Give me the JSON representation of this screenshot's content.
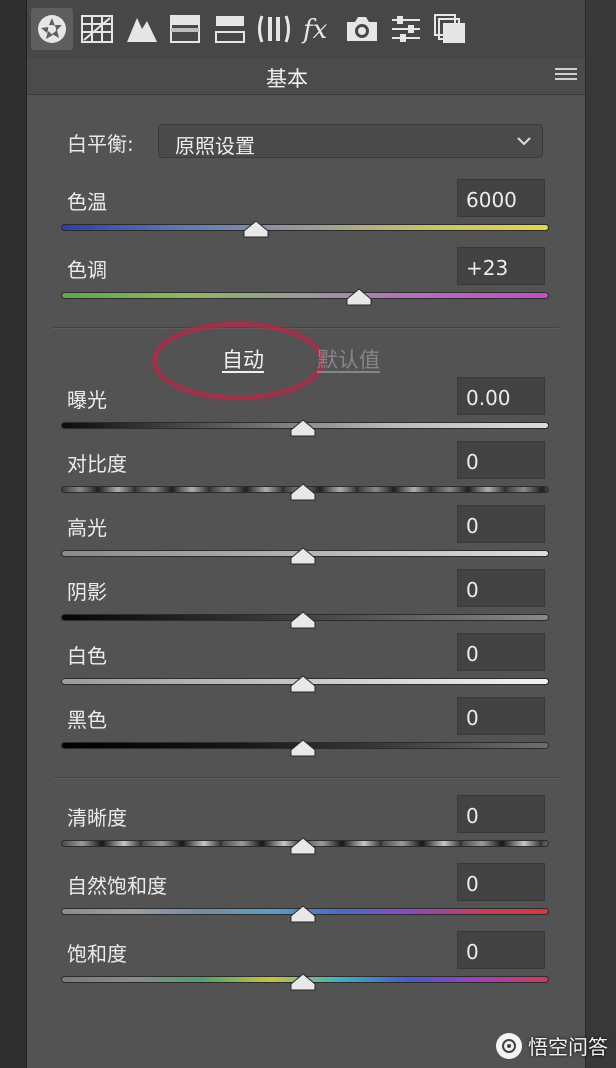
{
  "section": {
    "title": "基本"
  },
  "white_balance": {
    "label": "白平衡:",
    "value": "原照设置"
  },
  "top_sliders": [
    {
      "id": "temperature",
      "label": "色温",
      "value": "6000",
      "thumb_fraction": 0.4
    },
    {
      "id": "tint",
      "label": "色调",
      "value": "+23",
      "thumb_fraction": 0.61
    }
  ],
  "links": {
    "auto": "自动",
    "default": "默认值"
  },
  "tone_sliders": [
    {
      "id": "exposure",
      "label": "曝光",
      "value": "0.00"
    },
    {
      "id": "contrast",
      "label": "对比度",
      "value": "0"
    },
    {
      "id": "highlights",
      "label": "高光",
      "value": "0"
    },
    {
      "id": "shadows",
      "label": "阴影",
      "value": "0"
    },
    {
      "id": "whites",
      "label": "白色",
      "value": "0"
    },
    {
      "id": "blacks",
      "label": "黑色",
      "value": "0"
    }
  ],
  "presence_sliders": [
    {
      "id": "clarity",
      "label": "清晰度",
      "value": "0"
    },
    {
      "id": "vibrance",
      "label": "自然饱和度",
      "value": "0"
    },
    {
      "id": "saturation",
      "label": "饱和度",
      "value": "0"
    }
  ],
  "watermark": {
    "text": "悟空问答"
  },
  "toolbar_icons": [
    "aperture-icon",
    "grid-icon",
    "mountain-icon",
    "gradient-icon",
    "split-tone-icon",
    "lens-icon",
    "fx-icon",
    "camera-icon",
    "sliders-icon",
    "stack-icon"
  ],
  "colors": {
    "panel": "#535353",
    "annotation": "#b42846"
  }
}
